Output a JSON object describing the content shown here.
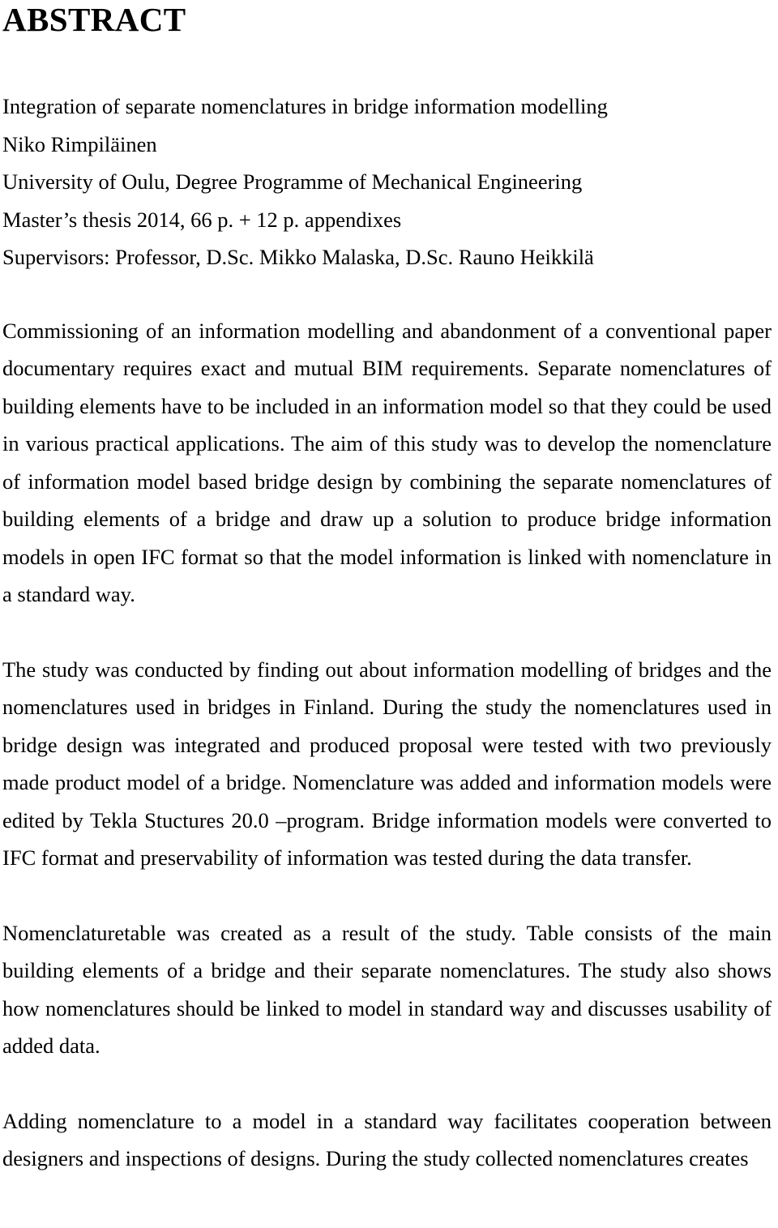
{
  "document": {
    "heading": "ABSTRACT",
    "metadata": [
      {
        "name": "thesis-title",
        "text": "Integration of separate nomenclatures in bridge information modelling"
      },
      {
        "name": "author-name",
        "text": "Niko Rimpiläinen"
      },
      {
        "name": "university-and-programme",
        "text": "University of Oulu, Degree Programme of Mechanical Engineering"
      },
      {
        "name": "thesis-type-and-pages",
        "text": "Master’s thesis 2014, 66 p. + 12 p. appendixes"
      },
      {
        "name": "supervisors",
        "text": "Supervisors: Professor, D.Sc. Mikko Malaska, D.Sc. Rauno Heikkilä"
      }
    ],
    "paragraphs": [
      {
        "name": "abstract-paragraph-1",
        "text": "Commissioning of an information modelling and abandonment of a conventional paper documentary requires exact and mutual BIM requirements. Separate nomenclatures of building elements have to be included in an information model so that they could be used in various practical applications. The aim of this study was to develop the nomenclature of information model based bridge design by combining the separate nomenclatures of building elements of a bridge and draw up a solution to produce bridge information models in open IFC format so that the model information is linked with nomenclature in a standard way."
      },
      {
        "name": "abstract-paragraph-2",
        "text": "The study was conducted by finding out about information modelling of bridges and the nomenclatures used in bridges in Finland. During the study the nomenclatures used in bridge design was integrated and produced proposal were tested with two previously made product model of a bridge. Nomenclature was added and information models were edited by Tekla Stuctures 20.0 –program. Bridge information models were converted to IFC format and preservability of information was tested during the data transfer."
      },
      {
        "name": "abstract-paragraph-3",
        "text": "Nomenclaturetable was created as a result of the study. Table consists of the main building elements of a bridge and their separate nomenclatures. The study also shows how nomenclatures should be linked to model in standard way and discusses usability of added data."
      },
      {
        "name": "abstract-paragraph-4",
        "text": "Adding nomenclature to a model in a standard way facilitates cooperation between designers and inspections of designs. During the study collected nomenclatures creates"
      }
    ]
  }
}
